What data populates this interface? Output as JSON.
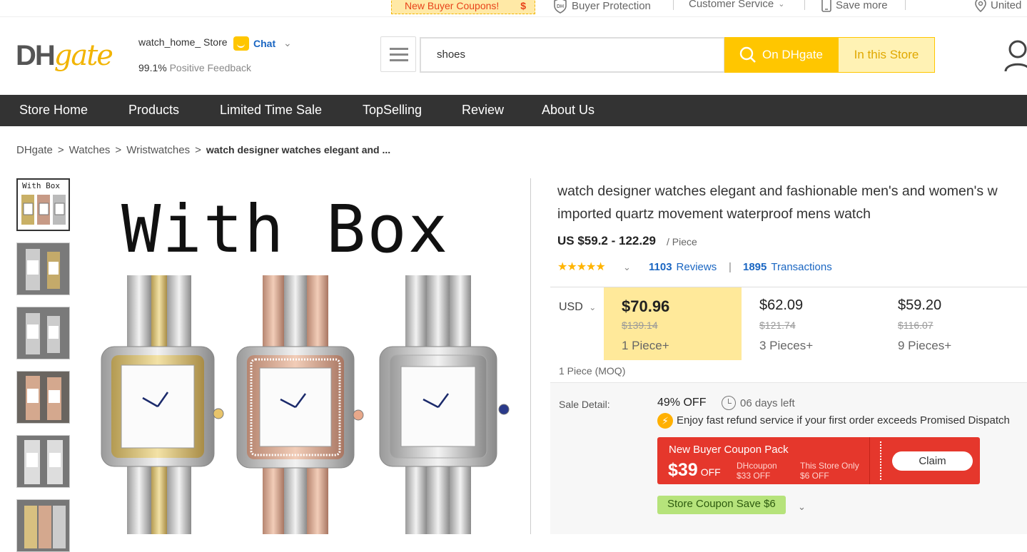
{
  "topbar": {
    "coupon": "New Buyer Coupons!",
    "coupon_symbol": "$",
    "buyer_protection": "Buyer Protection",
    "customer_service": "Customer Service",
    "save_more": "Save more",
    "region": "United"
  },
  "header": {
    "logo_dh": "DH",
    "logo_gate": "gate",
    "store_name": "watch_home_ Store",
    "chat_label": "Chat",
    "feedback_pct": "99.1%",
    "feedback_label": "Positive Feedback",
    "search_value": "shoes",
    "btn_dhgate": "On DHgate",
    "btn_store": "In this Store"
  },
  "nav": {
    "items": [
      "Store Home",
      "Products",
      "Limited Time Sale",
      "TopSelling",
      "Review",
      "About Us"
    ]
  },
  "breadcrumb": [
    "DHgate",
    "Watches",
    "Wristwatches",
    "watch designer watches elegant and ..."
  ],
  "gallery": {
    "main_caption": "With Box",
    "thumb_caption": "With Box"
  },
  "product": {
    "title_line1": "watch designer watches elegant and fashionable men's and women's w",
    "title_line2": "imported quartz movement waterproof mens watch",
    "price_range": "US $59.2 - 122.29",
    "per_piece": "/ Piece",
    "reviews_count": "1103",
    "reviews_label": "Reviews",
    "transactions_count": "1895",
    "transactions_label": "Transactions",
    "rating_stars": 5,
    "currency": "USD",
    "tiers": [
      {
        "price": "$70.96",
        "orig": "$139.14",
        "qty": "1 Piece+"
      },
      {
        "price": "$62.09",
        "orig": "$121.74",
        "qty": "3 Pieces+"
      },
      {
        "price": "$59.20",
        "orig": "$116.07",
        "qty": "9 Pieces+"
      }
    ],
    "moq": "1 Piece (MOQ)"
  },
  "sale": {
    "label": "Sale Detail:",
    "off": "49% OFF",
    "days_left": "06 days left",
    "refund_text": "Enjoy fast refund service if your first order exceeds Promised Dispatch",
    "coupon_title": "New Buyer Coupon Pack",
    "coupon_amount": "$39",
    "coupon_off": "OFF",
    "dh_coupon_label": "DHcoupon",
    "dh_coupon_value": "$33 OFF",
    "store_only_label": "This Store Only",
    "store_only_value": "$6 OFF",
    "claim": "Claim",
    "store_coupon": "Store Coupon Save $6"
  },
  "colors": {
    "accent": "#ffc600",
    "nav_bg": "#333333",
    "link": "#1a66c2",
    "coupon_red": "#e5372c",
    "store_coupon_green": "#b6e37b"
  }
}
